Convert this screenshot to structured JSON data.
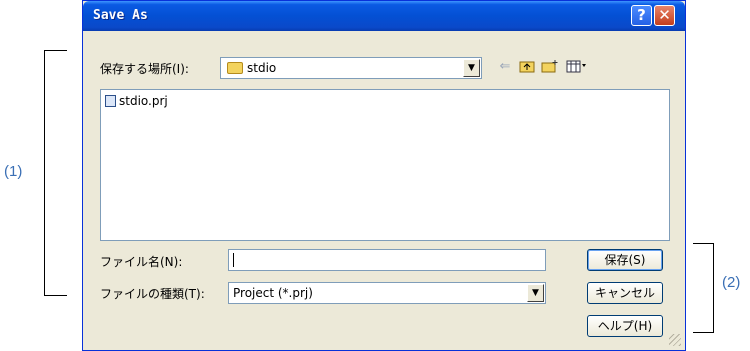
{
  "dialog": {
    "title": "Save As",
    "help_button": "?",
    "close_button": "✕"
  },
  "save_in": {
    "label": "保存する場所(I):",
    "value": "stdio"
  },
  "toolbar_icons": [
    "back-icon",
    "up-folder-icon",
    "new-folder-icon",
    "view-menu-icon"
  ],
  "files": [
    {
      "name": "stdio.prj"
    }
  ],
  "file_name": {
    "label": "ファイル名(N):",
    "value": ""
  },
  "file_type": {
    "label": "ファイルの種類(T):",
    "value": "Project (*.prj)"
  },
  "buttons": {
    "save": "保存(S)",
    "cancel": "キャンセル",
    "help": "ヘルプ(H)"
  },
  "annotations": {
    "left": "(1)",
    "right": "(2)"
  }
}
